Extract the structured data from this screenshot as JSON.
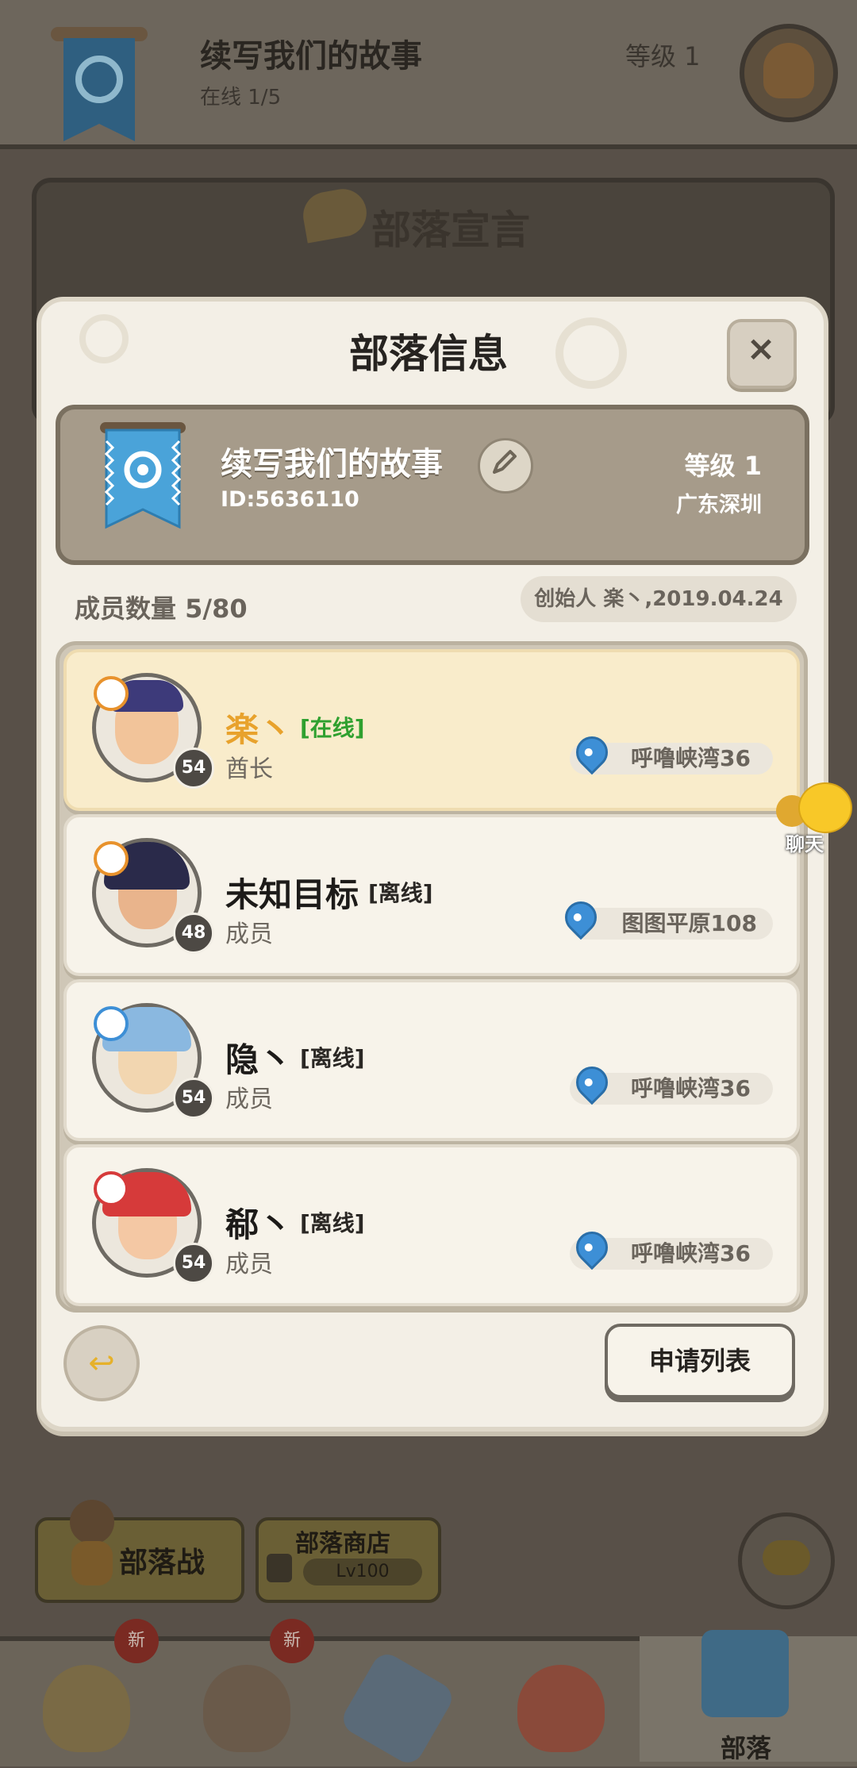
{
  "header": {
    "tribe_name": "续写我们的故事",
    "online": "在线 1/5",
    "level": "等级 1"
  },
  "declaration": {
    "title": "部落宣言"
  },
  "modal": {
    "title": "部落信息",
    "close_label": "×",
    "tribe": {
      "name": "续写我们的故事",
      "id": "ID:5636110",
      "level": "等级 1",
      "region": "广东深圳"
    },
    "member_count": "成员数量 5/80",
    "founder": "创始人 楽丶,2019.04.24",
    "members": [
      {
        "name": "楽丶",
        "status": "[在线]",
        "role": "酋长",
        "level": "54",
        "location": "呼噜峡湾36",
        "role_color": "#e8922c"
      },
      {
        "name": "未知目标",
        "status": "[离线]",
        "role": "成员",
        "level": "48",
        "location": "图图平原108",
        "role_color": "#e8922c"
      },
      {
        "name": "隐丶",
        "status": "[离线]",
        "role": "成员",
        "level": "54",
        "location": "呼噜峡湾36",
        "role_color": "#3d8fd6"
      },
      {
        "name": "郗丶",
        "status": "[离线]",
        "role": "成员",
        "level": "54",
        "location": "呼噜峡湾36",
        "role_color": "#d63a3a"
      }
    ],
    "apply_button": "申请列表"
  },
  "chat_float": {
    "label": "聊天"
  },
  "actions": {
    "tribe_war": "部落战",
    "tribe_shop": "部落商店",
    "shop_lock_level": "Lv100"
  },
  "bottom_nav": {
    "badge_new": "新",
    "tribe_label": "部落"
  },
  "colors": {
    "accent_gold": "#e8a22c",
    "online_green": "#2fa02f",
    "banner_blue": "#4aa3d9"
  }
}
